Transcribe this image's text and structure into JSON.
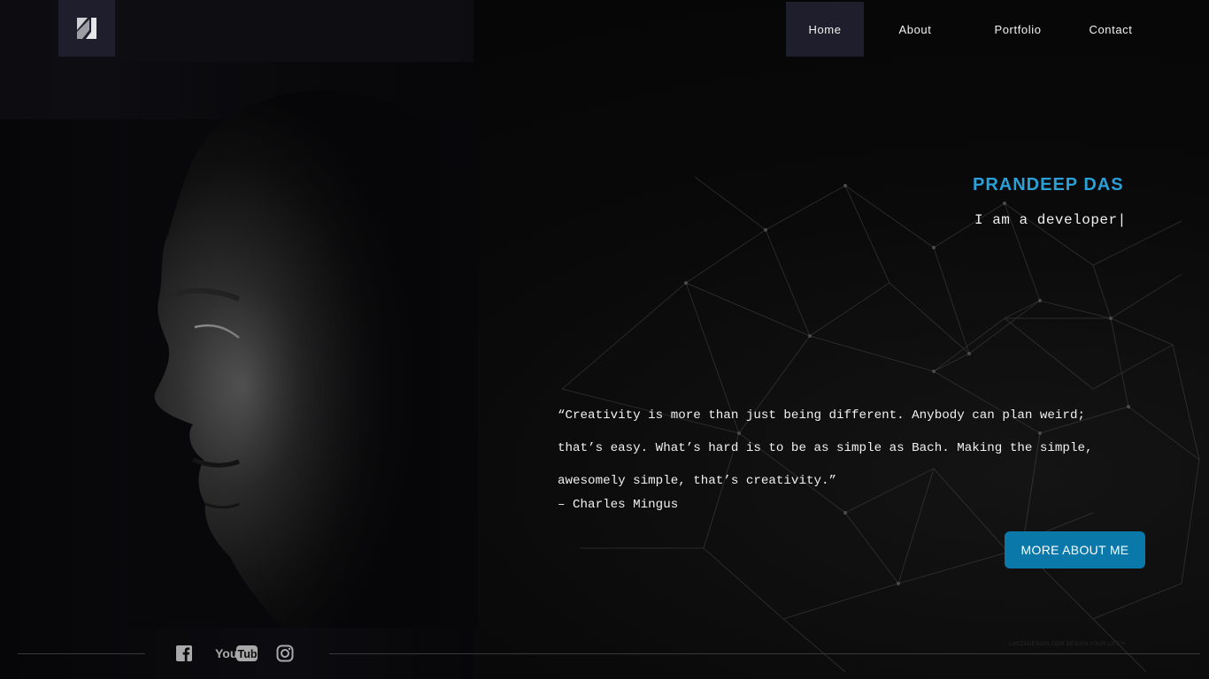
{
  "nav": {
    "items": [
      {
        "label": "Home",
        "active": true
      },
      {
        "label": "About",
        "active": false
      },
      {
        "label": "Portfolio",
        "active": false
      },
      {
        "label": "Contact",
        "active": false
      }
    ]
  },
  "hero": {
    "name": "PRANDEEP DAS",
    "tagline": "I am a developer|",
    "quote_lines": [
      "“Creativity is more than just being different. Anybody can plan weird;",
      "that’s easy. What’s hard is to be as simple as Bach. Making the simple,",
      "awesomely simple, that’s creativity.”"
    ],
    "quote_author": "– Charles Mingus",
    "cta_label": "MORE ABOUT ME"
  },
  "footer": {
    "social": [
      {
        "name": "facebook-icon",
        "label": "f"
      },
      {
        "name": "youtube-icon",
        "label_you": "You",
        "label_tube": "Tube"
      },
      {
        "name": "instagram-icon"
      }
    ],
    "watermark": "LACZADESIGN.COM DESIGN YOUR LIFE™"
  },
  "colors": {
    "accent": "#2aa0d8",
    "button": "#0a78a8",
    "nav_active": "#1f1e2c",
    "background": "#050506"
  }
}
